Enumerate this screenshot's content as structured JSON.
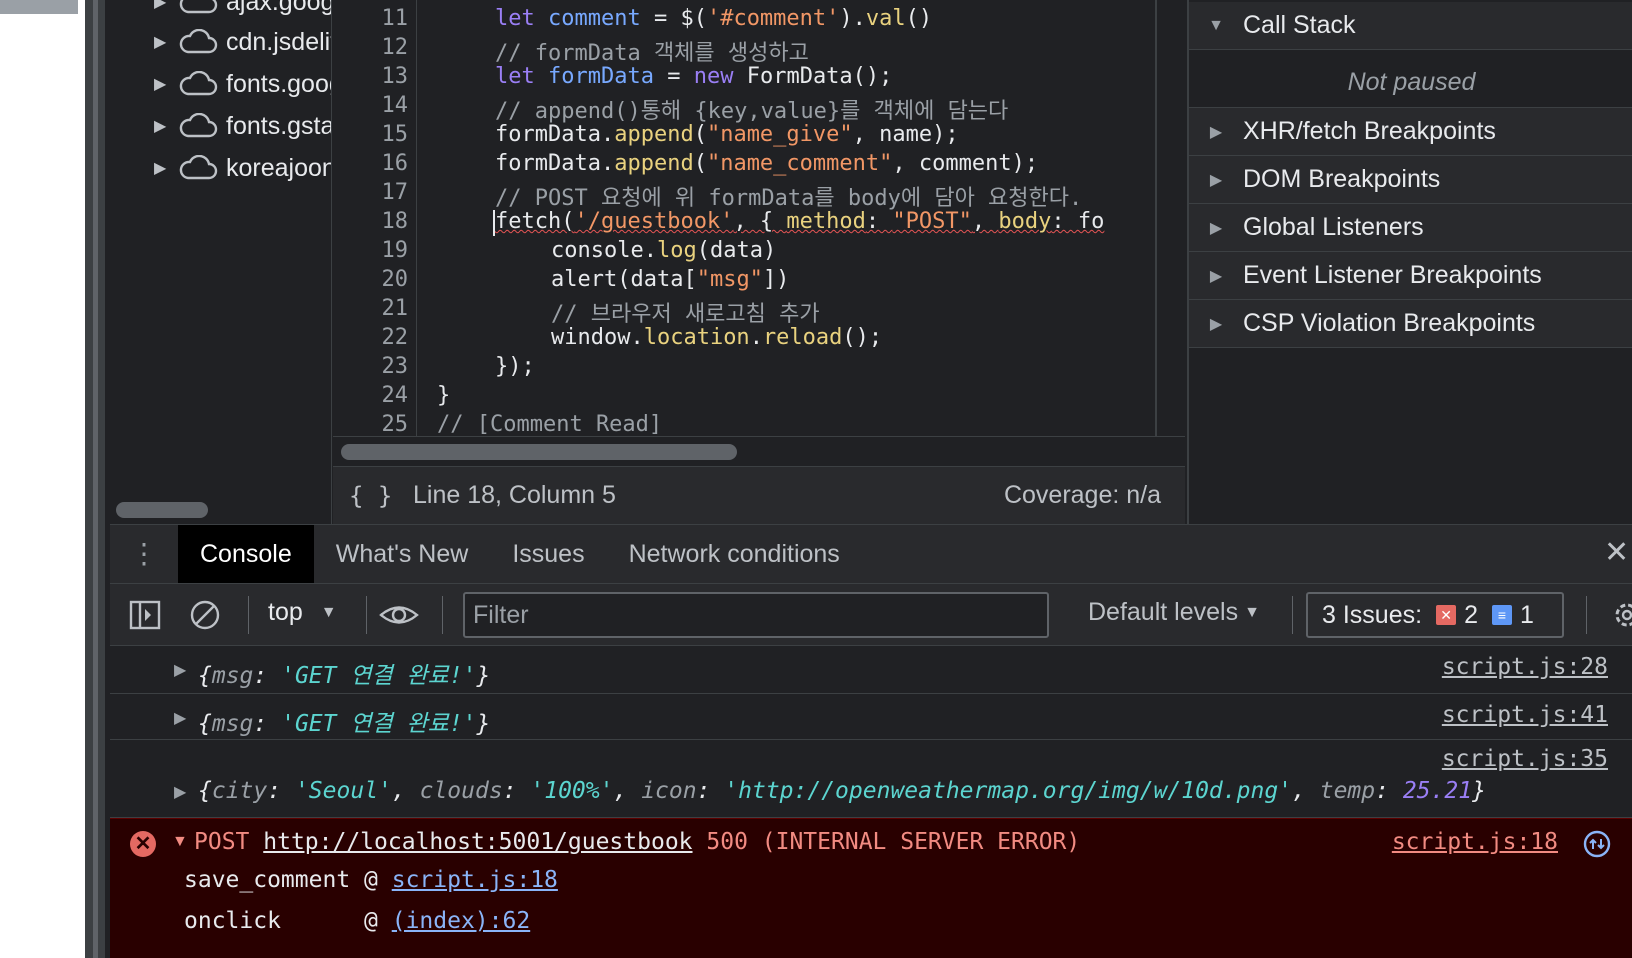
{
  "navigator": {
    "items": [
      {
        "label": "ajax.googleapis.com"
      },
      {
        "label": "cdn.jsdelivr.net"
      },
      {
        "label": "fonts.googleapis.com"
      },
      {
        "label": "fonts.gstatic.com"
      },
      {
        "label": "koreajoongang"
      }
    ]
  },
  "editor": {
    "lines": [
      {
        "num": "11"
      },
      {
        "num": "12"
      },
      {
        "num": "13"
      },
      {
        "num": "14"
      },
      {
        "num": "15"
      },
      {
        "num": "16"
      },
      {
        "num": "17"
      },
      {
        "num": "18"
      },
      {
        "num": "19"
      },
      {
        "num": "20"
      },
      {
        "num": "21"
      },
      {
        "num": "22"
      },
      {
        "num": "23"
      },
      {
        "num": "24"
      },
      {
        "num": "25"
      }
    ],
    "code": {
      "l11_kw": "let",
      "l11_var": "comment",
      "l11_a": " = $(",
      "l11_str": "'#comment'",
      "l11_b": ").",
      "l11_fn": "val",
      "l11_c": "()",
      "l12": "// formData 객체를 생성하고",
      "l13_kw": "let",
      "l13_var": "formData",
      "l13_a": " = ",
      "l13_kw2": "new",
      "l13_b": " FormData();",
      "l14": "// append()통해 {key,value}를 객체에 담는다",
      "l15_a": "formData.",
      "l15_fn": "append",
      "l15_b": "(",
      "l15_str": "\"name_give\"",
      "l15_c": ", name);",
      "l16_a": "formData.",
      "l16_fn": "append",
      "l16_b": "(",
      "l16_str": "\"name_comment\"",
      "l16_c": ", comment);",
      "l17": "// POST 요청에 위 formData를 body에 담아 요청한다.",
      "l18_a": "fetch(",
      "l18_str": "'/guestbook'",
      "l18_b": ", { ",
      "l18_p1": "method",
      "l18_c": ": ",
      "l18_str2": "\"POST\"",
      "l18_d": ", ",
      "l18_p2": "body",
      "l18_e": ": fo",
      "l19_a": "console.",
      "l19_fn": "log",
      "l19_b": "(data)",
      "l20_a": "alert(data[",
      "l20_str": "\"msg\"",
      "l20_b": "])",
      "l21": "// 브라우저 새로고침 추가",
      "l22_a": "window.",
      "l22_p": "location",
      "l22_b": ".",
      "l22_fn": "reload",
      "l22_c": "();",
      "l23": "});",
      "l24": "}",
      "l25": "// [Comment Read]"
    }
  },
  "statusbar": {
    "braces": "{ }",
    "position": "Line 18, Column 5",
    "coverage": "Coverage: n/a"
  },
  "debugger": {
    "call_stack": "Call Stack",
    "not_paused": "Not paused",
    "sections": [
      "XHR/fetch Breakpoints",
      "DOM Breakpoints",
      "Global Listeners",
      "Event Listener Breakpoints",
      "CSP Violation Breakpoints"
    ]
  },
  "drawer": {
    "tabs": [
      "Console",
      "What's New",
      "Issues",
      "Network conditions"
    ],
    "close": "✕"
  },
  "toolbar": {
    "context": "top",
    "filter_placeholder": "Filter",
    "levels": "Default levels",
    "issues_label": "3 Issues:",
    "issues_errors": "2",
    "issues_info": "1"
  },
  "console": {
    "msg1": {
      "key": "msg",
      "val": "'GET 연결 완료!'",
      "src": "script.js:28"
    },
    "msg2": {
      "key": "msg",
      "val": "'GET 연결 완료!'",
      "src": "script.js:41"
    },
    "msg3": {
      "src": "script.js:35",
      "k1": "city",
      "v1": "'Seoul'",
      "k2": "clouds",
      "v2": "'100%'",
      "k3": "icon",
      "v3": "'http://openweathermap.org/img/w/10d.png'",
      "k4": "temp",
      "v4": "25.21"
    },
    "error": {
      "method": "POST",
      "url": "http://localhost:5001/guestbook",
      "status": "500 (INTERNAL SERVER ERROR)",
      "src": "script.js:18",
      "stack": [
        {
          "fn": "save_comment @ ",
          "link": "script.js:18"
        },
        {
          "fn": "onclick      @ ",
          "link": "(index):62"
        }
      ]
    }
  },
  "colors": {
    "background": "#202124",
    "panel": "#292a2d",
    "error_bg": "#290000",
    "error_text": "#f28b82",
    "string": "#5cd5d0",
    "keyword": "#9a7ff5"
  }
}
